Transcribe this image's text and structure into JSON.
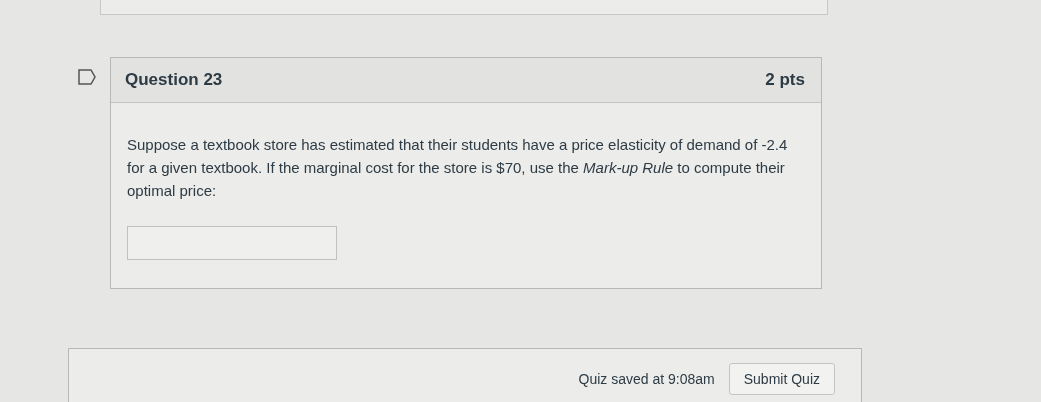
{
  "question": {
    "title": "Question 23",
    "points": "2 pts",
    "text": "Suppose a textbook store has estimated that their students have a price elasticity of demand of -2.4 for a given textbook. If the marginal cost for the store is $70, use the *Mark-up Rule* to compute their optimal price:"
  },
  "footer": {
    "saved": "Quiz saved at 9:08am",
    "submit": "Submit Quiz"
  }
}
